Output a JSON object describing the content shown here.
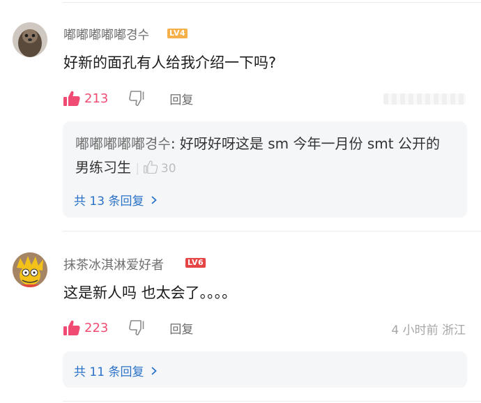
{
  "comments": [
    {
      "username": "嘟嘟嘟嘟嘟경수",
      "level": "LV4",
      "text": "好新的面孔有人给我介绍一下吗?",
      "likes": "213",
      "reply_label": "回复",
      "meta": "",
      "reply": {
        "author": "嘟嘟嘟嘟嘟경수",
        "text": ": 好呀好呀这是 sm 今年一月份 smt 公开的男练习生",
        "likes": "30"
      },
      "more_replies": "共 13 条回复"
    },
    {
      "username": "抹茶冰淇淋爱好者",
      "level": "LV6",
      "text": "这是新人吗 也太会了。。。。",
      "likes": "223",
      "reply_label": "回复",
      "meta": "4 小时前 浙江",
      "more_replies": "共 11 条回复"
    }
  ],
  "colors": {
    "like_pink": "#f04c73",
    "link_blue": "#2a72c8",
    "level4_orange": "#f5b04a",
    "level6_red": "#e64545"
  },
  "icons": [
    "thumbs-up-icon",
    "thumbs-down-icon",
    "chevron-right-icon"
  ]
}
